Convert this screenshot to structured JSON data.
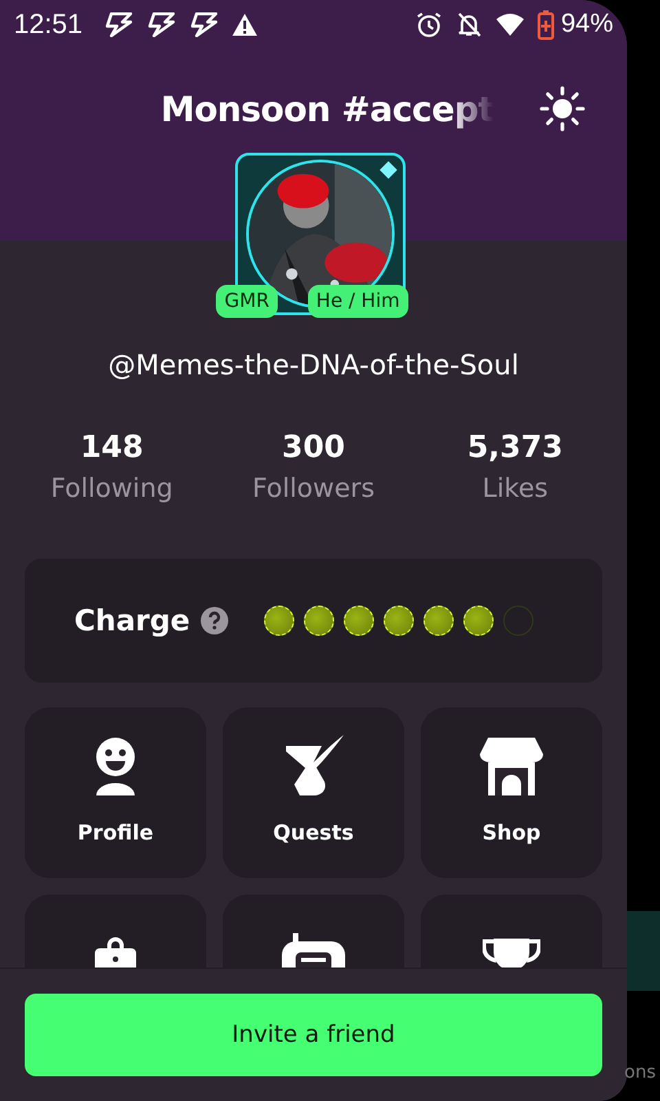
{
  "status_bar": {
    "time": "12:51",
    "battery": "94%"
  },
  "header": {
    "title": "Monsoon #accept"
  },
  "profile": {
    "badges": [
      "GMR",
      "He / Him"
    ],
    "username": "@Memes-the-DNA-of-the-Soul"
  },
  "stats": [
    {
      "value": "148",
      "label": "Following"
    },
    {
      "value": "300",
      "label": "Followers"
    },
    {
      "value": "5,373",
      "label": "Likes"
    }
  ],
  "charge": {
    "label": "Charge",
    "dots": [
      {
        "filled": true
      },
      {
        "filled": true
      },
      {
        "filled": true
      },
      {
        "filled": true
      },
      {
        "filled": true
      },
      {
        "filled": true
      },
      {
        "filled": false
      }
    ]
  },
  "tiles": [
    {
      "kind": "labeled",
      "label": "Profile"
    },
    {
      "kind": "labeled",
      "label": "Quests"
    },
    {
      "kind": "labeled",
      "label": "Shop"
    },
    {
      "kind": "partial"
    },
    {
      "kind": "partial"
    },
    {
      "kind": "partial"
    }
  ],
  "invite_button": {
    "label": "Invite a friend"
  },
  "background_app": {
    "text": "ons"
  }
}
